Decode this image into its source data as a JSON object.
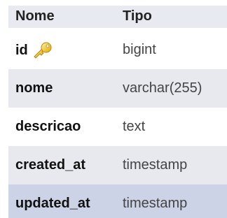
{
  "table": {
    "headers": {
      "name": "Nome",
      "type": "Tipo"
    },
    "rows": [
      {
        "name": "id",
        "type": "bigint",
        "icon": "key-icon"
      },
      {
        "name": "nome",
        "type": "varchar(255)"
      },
      {
        "name": "descricao",
        "type": "text"
      },
      {
        "name": "created_at",
        "type": "timestamp"
      },
      {
        "name": "updated_at",
        "type": "timestamp"
      }
    ]
  }
}
